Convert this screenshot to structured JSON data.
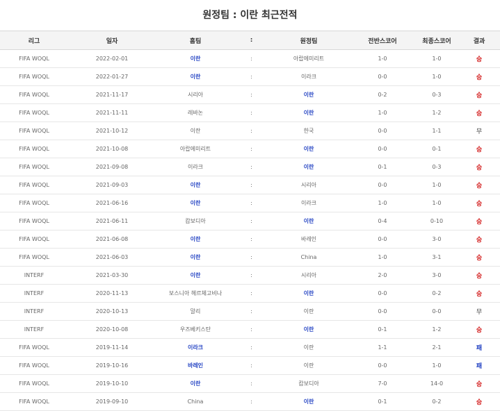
{
  "title": "원정팀 : 이란 최근전적",
  "columns": [
    "리그",
    "일자",
    "홈팀",
    ":",
    "원정팀",
    "전반스코어",
    "최종스코어",
    "결과"
  ],
  "matches": [
    {
      "league": "FIFA WOQL",
      "date": "2022-02-01",
      "home": "이란",
      "away": "아랍에미리트",
      "half": "1-0",
      "final": "1-0",
      "result": "승",
      "highlight": "home",
      "res_type": "win"
    },
    {
      "league": "FIFA WOQL",
      "date": "2022-01-27",
      "home": "이란",
      "away": "이라크",
      "half": "0-0",
      "final": "1-0",
      "result": "승",
      "highlight": "home",
      "res_type": "win"
    },
    {
      "league": "FIFA WOQL",
      "date": "2021-11-17",
      "home": "시리아",
      "away": "이란",
      "half": "0-2",
      "final": "0-3",
      "result": "승",
      "highlight": "away",
      "res_type": "win"
    },
    {
      "league": "FIFA WOQL",
      "date": "2021-11-11",
      "home": "레바논",
      "away": "이란",
      "half": "1-0",
      "final": "1-2",
      "result": "승",
      "highlight": "away",
      "res_type": "win"
    },
    {
      "league": "FIFA WOQL",
      "date": "2021-10-12",
      "home": "이란",
      "away": "한국",
      "half": "0-0",
      "final": "1-1",
      "result": "무",
      "highlight": "none",
      "res_type": "draw"
    },
    {
      "league": "FIFA WOQL",
      "date": "2021-10-08",
      "home": "아랍에미리트",
      "away": "이란",
      "half": "0-0",
      "final": "0-1",
      "result": "승",
      "highlight": "away",
      "res_type": "win"
    },
    {
      "league": "FIFA WOQL",
      "date": "2021-09-08",
      "home": "이라크",
      "away": "이란",
      "half": "0-1",
      "final": "0-3",
      "result": "승",
      "highlight": "away",
      "res_type": "win"
    },
    {
      "league": "FIFA WOQL",
      "date": "2021-09-03",
      "home": "이란",
      "away": "시리아",
      "half": "0-0",
      "final": "1-0",
      "result": "승",
      "highlight": "home",
      "res_type": "win"
    },
    {
      "league": "FIFA WOQL",
      "date": "2021-06-16",
      "home": "이란",
      "away": "이라크",
      "half": "1-0",
      "final": "1-0",
      "result": "승",
      "highlight": "home",
      "res_type": "win"
    },
    {
      "league": "FIFA WOQL",
      "date": "2021-06-11",
      "home": "캄보디아",
      "away": "이란",
      "half": "0-4",
      "final": "0-10",
      "result": "승",
      "highlight": "away",
      "res_type": "win"
    },
    {
      "league": "FIFA WOQL",
      "date": "2021-06-08",
      "home": "이란",
      "away": "바레인",
      "half": "0-0",
      "final": "3-0",
      "result": "승",
      "highlight": "home",
      "res_type": "win"
    },
    {
      "league": "FIFA WOQL",
      "date": "2021-06-03",
      "home": "이란",
      "away": "China",
      "half": "1-0",
      "final": "3-1",
      "result": "승",
      "highlight": "home",
      "res_type": "win"
    },
    {
      "league": "INTERF",
      "date": "2021-03-30",
      "home": "이란",
      "away": "시리아",
      "half": "2-0",
      "final": "3-0",
      "result": "승",
      "highlight": "home",
      "res_type": "win"
    },
    {
      "league": "INTERF",
      "date": "2020-11-13",
      "home": "보스니아 헤르체고비나",
      "away": "이란",
      "half": "0-0",
      "final": "0-2",
      "result": "승",
      "highlight": "away",
      "res_type": "win"
    },
    {
      "league": "INTERF",
      "date": "2020-10-13",
      "home": "말리",
      "away": "이란",
      "half": "0-0",
      "final": "0-0",
      "result": "무",
      "highlight": "none",
      "res_type": "draw"
    },
    {
      "league": "INTERF",
      "date": "2020-10-08",
      "home": "우즈베키스탄",
      "away": "이란",
      "half": "0-1",
      "final": "1-2",
      "result": "승",
      "highlight": "away",
      "res_type": "win"
    },
    {
      "league": "FIFA WOQL",
      "date": "2019-11-14",
      "home": "이라크",
      "away": "이란",
      "half": "1-1",
      "final": "2-1",
      "result": "패",
      "highlight": "home",
      "res_type": "lose"
    },
    {
      "league": "FIFA WOQL",
      "date": "2019-10-16",
      "home": "바레인",
      "away": "이란",
      "half": "0-0",
      "final": "1-0",
      "result": "패",
      "highlight": "home",
      "res_type": "lose"
    },
    {
      "league": "FIFA WOQL",
      "date": "2019-10-10",
      "home": "이란",
      "away": "캄보디아",
      "half": "7-0",
      "final": "14-0",
      "result": "승",
      "highlight": "home",
      "res_type": "win"
    },
    {
      "league": "FIFA WOQL",
      "date": "2019-09-10",
      "home": "China",
      "away": "이란",
      "half": "0-1",
      "final": "0-2",
      "result": "승",
      "highlight": "away",
      "res_type": "win"
    }
  ]
}
